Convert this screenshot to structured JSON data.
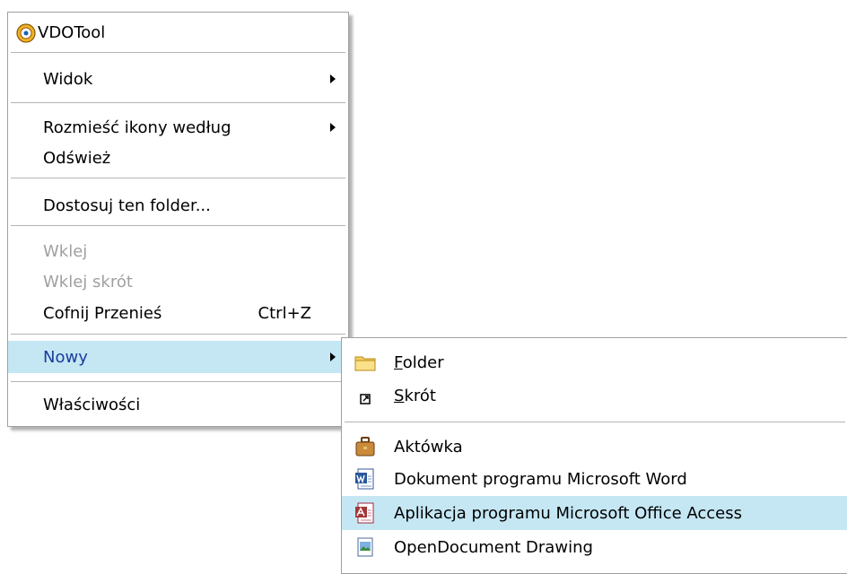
{
  "context_menu": {
    "title": "VDOTool",
    "items": [
      {
        "label": "Widok"
      },
      {
        "label": "Rozmieść ikony według"
      },
      {
        "label": "Odśwież"
      },
      {
        "label": "Dostosuj ten folder..."
      },
      {
        "label": "Wklej"
      },
      {
        "label": "Wklej skrót"
      },
      {
        "label": "Cofnij Przenieś",
        "shortcut": "Ctrl+Z"
      },
      {
        "label": "Nowy"
      },
      {
        "label": "Właściwości"
      }
    ]
  },
  "submenu": {
    "items": [
      {
        "accel": "F",
        "rest": "older",
        "icon": "folder-icon"
      },
      {
        "accel": "S",
        "rest": "krót",
        "icon": "shortcut-icon"
      },
      {
        "label": "Aktówka",
        "icon": "briefcase-icon"
      },
      {
        "label": "Dokument programu Microsoft Word",
        "icon": "word-document-icon"
      },
      {
        "label": "Aplikacja programu Microsoft Office Access",
        "icon": "access-application-icon"
      },
      {
        "label": "OpenDocument Drawing",
        "icon": "opendocument-drawing-icon"
      }
    ]
  },
  "colors": {
    "highlight_bg": "#c5e7f4",
    "highlight_text": "#1a3d9c",
    "disabled_text": "#a0a0a0",
    "separator": "#b4b4b4"
  }
}
